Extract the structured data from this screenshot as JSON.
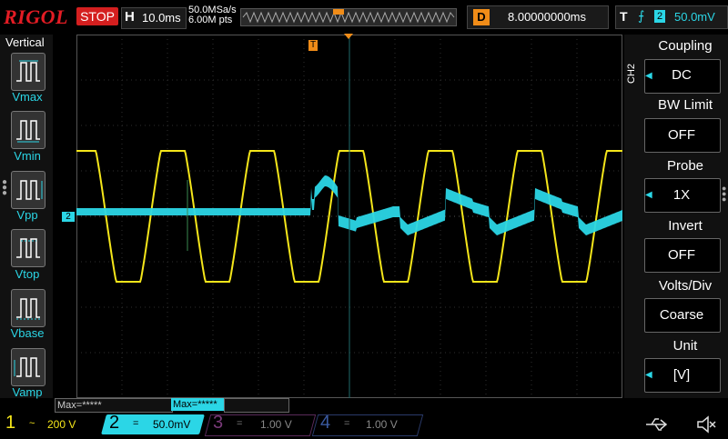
{
  "top": {
    "logo": "RIGOL",
    "run_state": "STOP",
    "timebase_label": "H",
    "timebase_value": "10.0ms",
    "sample_rate": "50.0MSa/s",
    "memory_depth": "6.00M pts",
    "delay_label": "D",
    "delay_value": "8.00000000ms",
    "trigger_label": "T",
    "trigger_source": "2",
    "trigger_level": "50.0mV"
  },
  "left_panel": {
    "title": "Vertical",
    "items": [
      {
        "label": "Vmax"
      },
      {
        "label": "Vmin"
      },
      {
        "label": "Vpp"
      },
      {
        "label": "Vtop"
      },
      {
        "label": "Vbase"
      },
      {
        "label": "Vamp"
      }
    ]
  },
  "right_menu": {
    "channel_tag": "CH2",
    "items": [
      {
        "title": "Coupling",
        "value": "DC"
      },
      {
        "title": "BW Limit",
        "value": "OFF"
      },
      {
        "title": "Probe",
        "value": "1X"
      },
      {
        "title": "Invert",
        "value": "OFF"
      },
      {
        "title": "Volts/Div",
        "value": "Coarse"
      },
      {
        "title": "Unit",
        "value": "[V]"
      }
    ]
  },
  "markers": {
    "ch2_ground": "2",
    "trigger_pos": "T"
  },
  "measurements": {
    "ch1_max": "Max=*****",
    "ch2_max": "Max=*****"
  },
  "channels": [
    {
      "num": "1",
      "coupling": "~",
      "scale": "200 V",
      "color": "#f5e61a"
    },
    {
      "num": "2",
      "coupling": "=",
      "scale": "50.0mV",
      "color": "#2bd6e6"
    },
    {
      "num": "3",
      "coupling": "=",
      "scale": "1.00 V",
      "color": "#d02bd6"
    },
    {
      "num": "4",
      "coupling": "=",
      "scale": "1.00 V",
      "color": "#2f6de0"
    }
  ],
  "colors": {
    "ch1": "#f5e61a",
    "ch2": "#2bd6e6",
    "trigger": "#f08c18",
    "stop": "#d41f1f"
  }
}
